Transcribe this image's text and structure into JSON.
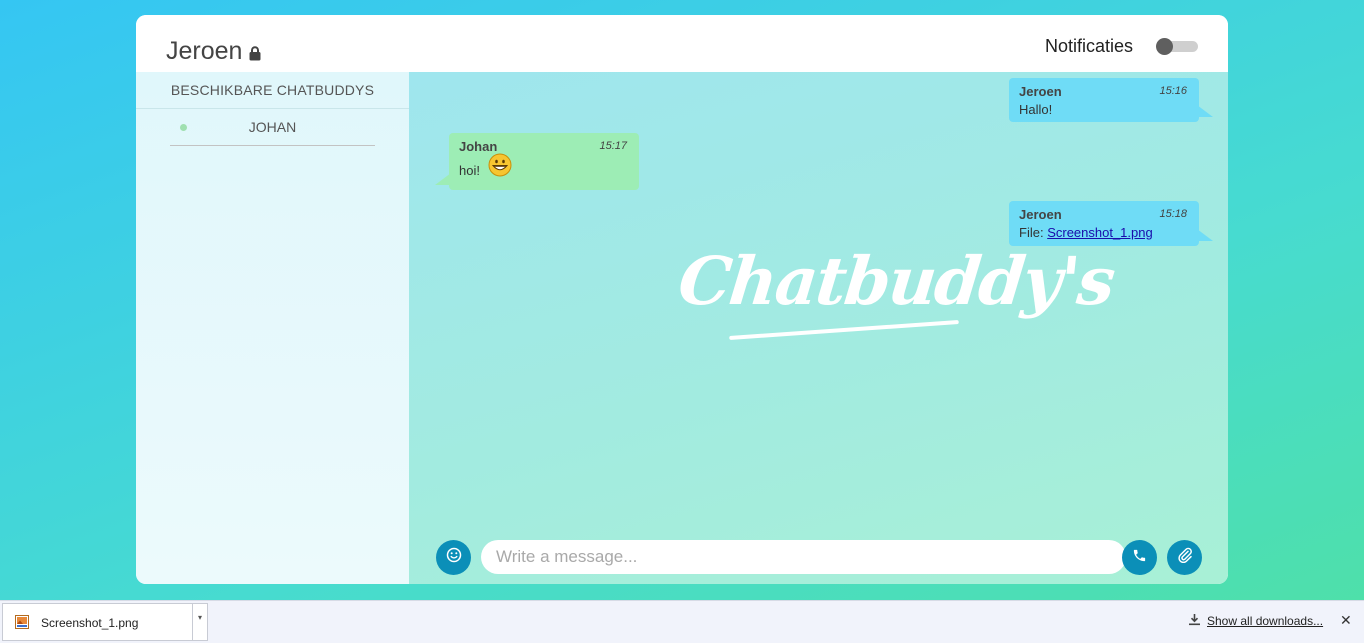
{
  "header": {
    "user_name": "Jeroen",
    "notifications_label": "Notificaties",
    "notifications_enabled": false
  },
  "sidebar": {
    "title": "BESCHIKBARE CHATBUDDYS",
    "buddies": [
      {
        "name": "JOHAN",
        "status": "online"
      }
    ]
  },
  "messages": [
    {
      "sender": "Jeroen",
      "time": "15:16",
      "text": "Hallo!",
      "direction": "outgoing"
    },
    {
      "sender": "Johan",
      "time": "15:17",
      "text": "hoi!",
      "emoji": "grinning-face",
      "direction": "incoming"
    },
    {
      "sender": "Jeroen",
      "time": "15:18",
      "file_prefix": "File:",
      "file_name": "Screenshot_1.png",
      "direction": "outgoing"
    }
  ],
  "logo_text": "Chatbuddy's",
  "composer": {
    "placeholder": "Write a message...",
    "emoji_icon": "smiley-icon",
    "call_icon": "phone-icon",
    "attach_icon": "paperclip-icon"
  },
  "downloads_bar": {
    "file_name": "Screenshot_1.png",
    "show_all_label": "Show all downloads..."
  },
  "colors": {
    "outgoing_bubble": "#6fdcf6",
    "incoming_bubble": "#9dedb5",
    "button_blue": "#0b8fb8",
    "online_dot": "#9fe0b0"
  }
}
